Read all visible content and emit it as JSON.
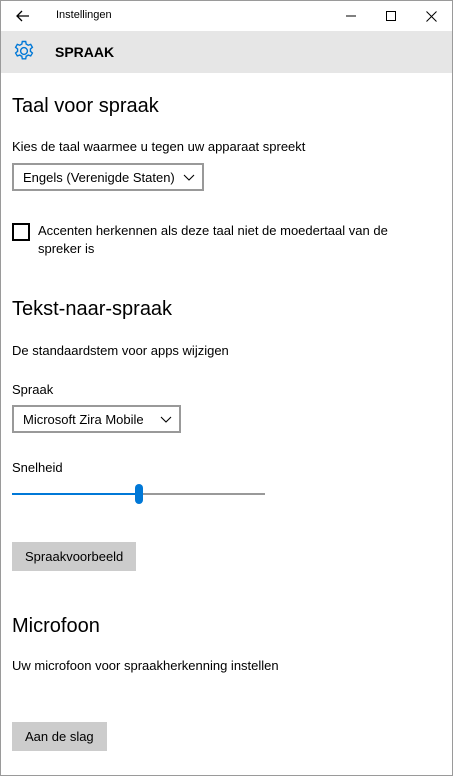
{
  "titlebar": {
    "title": "Instellingen"
  },
  "header": {
    "title": "SPRAAK"
  },
  "speech_language": {
    "heading": "Taal voor spraak",
    "description": "Kies de taal waarmee u tegen uw apparaat spreekt",
    "selected_language": "Engels (Verenigde Staten)",
    "accent_checkbox_label": "Accenten herkennen als deze taal niet de moedertaal van de spreker is",
    "accent_checked": false
  },
  "tts": {
    "heading": "Tekst-naar-spraak",
    "description": "De standaardstem voor apps wijzigen",
    "voice_label": "Spraak",
    "selected_voice": "Microsoft Zira Mobile",
    "speed_label": "Snelheid",
    "speed_fraction": 0.5,
    "preview_button": "Spraakvoorbeeld"
  },
  "microphone": {
    "heading": "Microfoon",
    "description": "Uw microfoon voor spraakherkenning instellen",
    "start_button": "Aan de slag"
  },
  "colors": {
    "accent": "#0078d7",
    "header_band": "#e6e6e6",
    "button_bg": "#cccccc",
    "combo_border": "#999999"
  },
  "icons": {
    "back": "arrow-left-icon",
    "minimize": "minimize-icon",
    "maximize": "maximize-icon",
    "close": "close-icon",
    "settings": "gear-icon",
    "dropdown": "chevron-down-icon"
  }
}
